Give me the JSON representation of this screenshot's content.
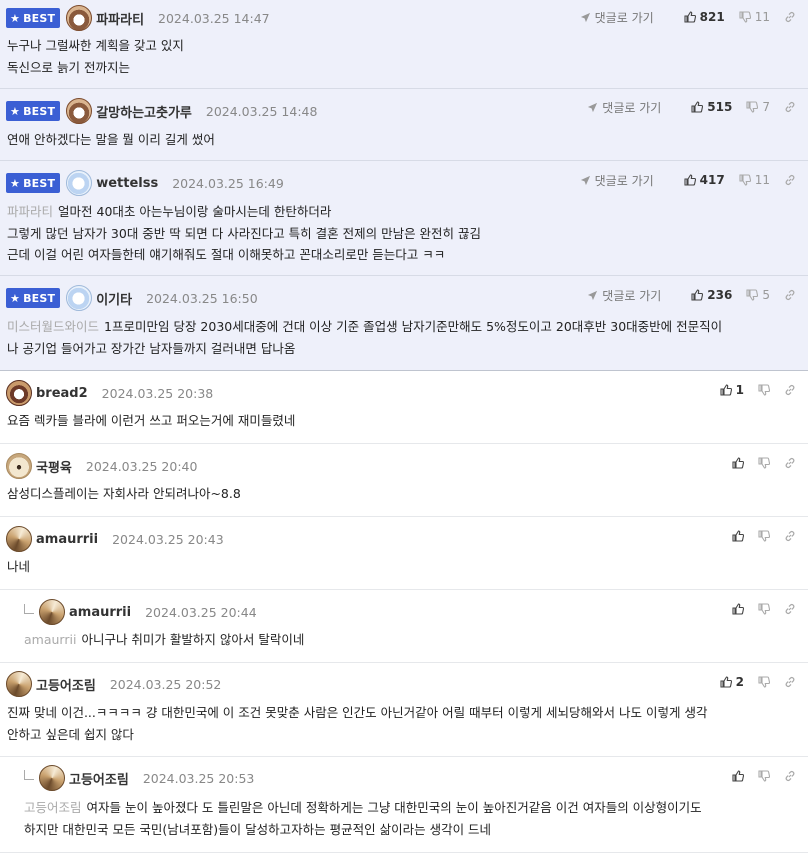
{
  "labels": {
    "best": "BEST",
    "reply_link": "댓글로 가기"
  },
  "comments": [
    {
      "best": true,
      "nickname": "파파라티",
      "time": "2024.03.25 14:47",
      "avatar": "dog-avatar",
      "lines": [
        "누구나 그럴싸한 계획을 갖고 있지",
        "독신으로 늙기 전까지는"
      ],
      "likes": "821",
      "dislikes": "11"
    },
    {
      "best": true,
      "nickname": "갈망하는고춧가루",
      "time": "2024.03.25 14:48",
      "avatar": "dog-avatar",
      "lines": [
        "연애 안하겠다는 말을 뭘 이리 길게 썼어"
      ],
      "likes": "515",
      "dislikes": "7"
    },
    {
      "best": true,
      "nickname": "wettelss",
      "time": "2024.03.25 16:49",
      "avatar": "cloud-avatar",
      "ref": "파파라티",
      "lines": [
        "얼마전 40대초 아는누님이랑 술마시는데 한탄하더라",
        "그렇게 많던 남자가 30대 중반 딱 되면 다 사라진다고 특히 결혼 전제의 만남은 완전히 끊김",
        "근데 이걸 어린 여자들한테 얘기해줘도 절대 이해못하고 꼰대소리로만 듣는다고 ㅋㅋ"
      ],
      "likes": "417",
      "dislikes": "11"
    },
    {
      "best": true,
      "nickname": "이기타",
      "time": "2024.03.25 16:50",
      "avatar": "cloud-avatar",
      "ref": "미스터월드와이드",
      "lines": [
        "1프로미만임 당장 2030세대중에 건대 이상 기준 졸업생 남자기준만해도 5%정도이고 20대후반 30대중반에 전문직이",
        "나 공기업 들어가고 장가간 남자들까지 걸러내면 답나옴"
      ],
      "likes": "236",
      "dislikes": "5"
    },
    {
      "best": false,
      "nickname": "bread2",
      "time": "2024.03.25 20:38",
      "avatar": "dog-avatar",
      "lines": [
        "요즘 렉카들 블라에 이런거 쓰고 퍼오는거에 재미들렸네"
      ],
      "likes": "1",
      "dislikes": ""
    },
    {
      "best": false,
      "nickname": "국평육",
      "time": "2024.03.25 20:40",
      "avatar": "puppy-avatar",
      "lines": [
        "삼성디스플레이는 자회사라 안되려나아~8.8"
      ],
      "likes": "",
      "dislikes": ""
    },
    {
      "best": false,
      "nickname": "amaurrii",
      "time": "2024.03.25 20:43",
      "avatar": "fox-avatar",
      "lines": [
        "나네"
      ],
      "likes": "",
      "dislikes": ""
    },
    {
      "best": false,
      "reply": true,
      "nickname": "amaurrii",
      "time": "2024.03.25 20:44",
      "avatar": "fox-avatar",
      "ref": "amaurrii",
      "lines": [
        "아니구나 취미가 활발하지 않아서 탈락이네"
      ],
      "likes": "",
      "dislikes": ""
    },
    {
      "best": false,
      "nickname": "고등어조림",
      "time": "2024.03.25 20:52",
      "avatar": "fox-avatar",
      "lines": [
        "진짜 맞네 이건...ㅋㅋㅋㅋ 걍 대한민국에 이 조건 못맞춘 사람은 인간도 아닌거같아 어릴 때부터 이렇게 세뇌당해와서 나도 이렇게 생각",
        "안하고 싶은데 쉽지 않다"
      ],
      "likes": "2",
      "dislikes": ""
    },
    {
      "best": false,
      "reply": true,
      "nickname": "고등어조림",
      "time": "2024.03.25 20:53",
      "avatar": "fox-avatar",
      "ref": "고등어조림",
      "lines": [
        "여자들 눈이 높아졌다 도 틀린말은 아닌데 정확하게는 그냥 대한민국의 눈이 높아진거같음 이건 여자들의 이상형이기도",
        "하지만 대한민국 모든 국민(남녀포함)들이 달성하고자하는 평균적인 삶이라는 생각이 드네"
      ],
      "likes": "",
      "dislikes": ""
    }
  ]
}
